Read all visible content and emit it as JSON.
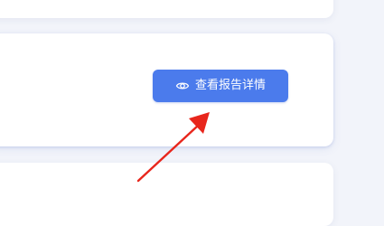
{
  "main": {
    "report_card": {
      "view_report_button": {
        "label": "查看报告详情",
        "icon": "eye-icon",
        "background_color": "#4b7bec"
      }
    }
  },
  "annotation": {
    "arrow_color": "#e8261c"
  }
}
